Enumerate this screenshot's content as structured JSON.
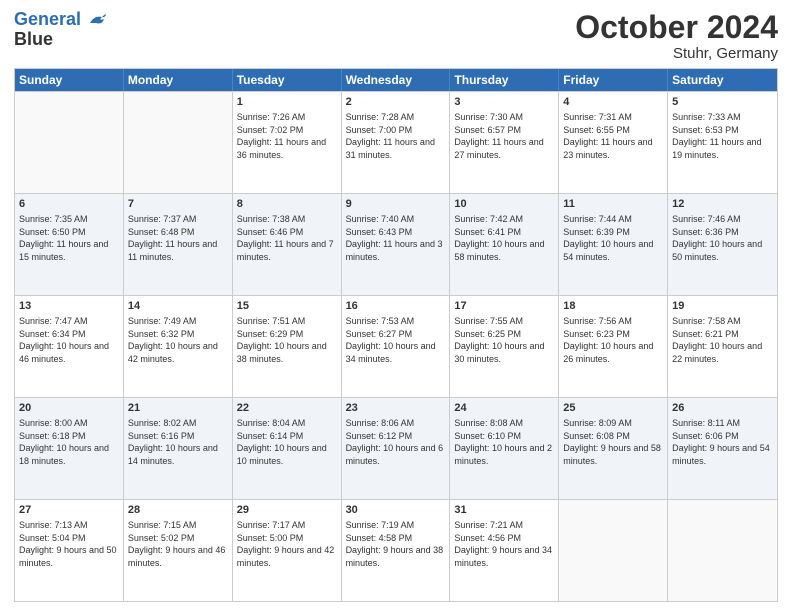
{
  "header": {
    "logo_line1": "General",
    "logo_line2": "Blue",
    "month": "October 2024",
    "location": "Stuhr, Germany"
  },
  "weekdays": [
    "Sunday",
    "Monday",
    "Tuesday",
    "Wednesday",
    "Thursday",
    "Friday",
    "Saturday"
  ],
  "rows": [
    [
      {
        "day": "",
        "sunrise": "",
        "sunset": "",
        "daylight": ""
      },
      {
        "day": "",
        "sunrise": "",
        "sunset": "",
        "daylight": ""
      },
      {
        "day": "1",
        "sunrise": "Sunrise: 7:26 AM",
        "sunset": "Sunset: 7:02 PM",
        "daylight": "Daylight: 11 hours and 36 minutes."
      },
      {
        "day": "2",
        "sunrise": "Sunrise: 7:28 AM",
        "sunset": "Sunset: 7:00 PM",
        "daylight": "Daylight: 11 hours and 31 minutes."
      },
      {
        "day": "3",
        "sunrise": "Sunrise: 7:30 AM",
        "sunset": "Sunset: 6:57 PM",
        "daylight": "Daylight: 11 hours and 27 minutes."
      },
      {
        "day": "4",
        "sunrise": "Sunrise: 7:31 AM",
        "sunset": "Sunset: 6:55 PM",
        "daylight": "Daylight: 11 hours and 23 minutes."
      },
      {
        "day": "5",
        "sunrise": "Sunrise: 7:33 AM",
        "sunset": "Sunset: 6:53 PM",
        "daylight": "Daylight: 11 hours and 19 minutes."
      }
    ],
    [
      {
        "day": "6",
        "sunrise": "Sunrise: 7:35 AM",
        "sunset": "Sunset: 6:50 PM",
        "daylight": "Daylight: 11 hours and 15 minutes."
      },
      {
        "day": "7",
        "sunrise": "Sunrise: 7:37 AM",
        "sunset": "Sunset: 6:48 PM",
        "daylight": "Daylight: 11 hours and 11 minutes."
      },
      {
        "day": "8",
        "sunrise": "Sunrise: 7:38 AM",
        "sunset": "Sunset: 6:46 PM",
        "daylight": "Daylight: 11 hours and 7 minutes."
      },
      {
        "day": "9",
        "sunrise": "Sunrise: 7:40 AM",
        "sunset": "Sunset: 6:43 PM",
        "daylight": "Daylight: 11 hours and 3 minutes."
      },
      {
        "day": "10",
        "sunrise": "Sunrise: 7:42 AM",
        "sunset": "Sunset: 6:41 PM",
        "daylight": "Daylight: 10 hours and 58 minutes."
      },
      {
        "day": "11",
        "sunrise": "Sunrise: 7:44 AM",
        "sunset": "Sunset: 6:39 PM",
        "daylight": "Daylight: 10 hours and 54 minutes."
      },
      {
        "day": "12",
        "sunrise": "Sunrise: 7:46 AM",
        "sunset": "Sunset: 6:36 PM",
        "daylight": "Daylight: 10 hours and 50 minutes."
      }
    ],
    [
      {
        "day": "13",
        "sunrise": "Sunrise: 7:47 AM",
        "sunset": "Sunset: 6:34 PM",
        "daylight": "Daylight: 10 hours and 46 minutes."
      },
      {
        "day": "14",
        "sunrise": "Sunrise: 7:49 AM",
        "sunset": "Sunset: 6:32 PM",
        "daylight": "Daylight: 10 hours and 42 minutes."
      },
      {
        "day": "15",
        "sunrise": "Sunrise: 7:51 AM",
        "sunset": "Sunset: 6:29 PM",
        "daylight": "Daylight: 10 hours and 38 minutes."
      },
      {
        "day": "16",
        "sunrise": "Sunrise: 7:53 AM",
        "sunset": "Sunset: 6:27 PM",
        "daylight": "Daylight: 10 hours and 34 minutes."
      },
      {
        "day": "17",
        "sunrise": "Sunrise: 7:55 AM",
        "sunset": "Sunset: 6:25 PM",
        "daylight": "Daylight: 10 hours and 30 minutes."
      },
      {
        "day": "18",
        "sunrise": "Sunrise: 7:56 AM",
        "sunset": "Sunset: 6:23 PM",
        "daylight": "Daylight: 10 hours and 26 minutes."
      },
      {
        "day": "19",
        "sunrise": "Sunrise: 7:58 AM",
        "sunset": "Sunset: 6:21 PM",
        "daylight": "Daylight: 10 hours and 22 minutes."
      }
    ],
    [
      {
        "day": "20",
        "sunrise": "Sunrise: 8:00 AM",
        "sunset": "Sunset: 6:18 PM",
        "daylight": "Daylight: 10 hours and 18 minutes."
      },
      {
        "day": "21",
        "sunrise": "Sunrise: 8:02 AM",
        "sunset": "Sunset: 6:16 PM",
        "daylight": "Daylight: 10 hours and 14 minutes."
      },
      {
        "day": "22",
        "sunrise": "Sunrise: 8:04 AM",
        "sunset": "Sunset: 6:14 PM",
        "daylight": "Daylight: 10 hours and 10 minutes."
      },
      {
        "day": "23",
        "sunrise": "Sunrise: 8:06 AM",
        "sunset": "Sunset: 6:12 PM",
        "daylight": "Daylight: 10 hours and 6 minutes."
      },
      {
        "day": "24",
        "sunrise": "Sunrise: 8:08 AM",
        "sunset": "Sunset: 6:10 PM",
        "daylight": "Daylight: 10 hours and 2 minutes."
      },
      {
        "day": "25",
        "sunrise": "Sunrise: 8:09 AM",
        "sunset": "Sunset: 6:08 PM",
        "daylight": "Daylight: 9 hours and 58 minutes."
      },
      {
        "day": "26",
        "sunrise": "Sunrise: 8:11 AM",
        "sunset": "Sunset: 6:06 PM",
        "daylight": "Daylight: 9 hours and 54 minutes."
      }
    ],
    [
      {
        "day": "27",
        "sunrise": "Sunrise: 7:13 AM",
        "sunset": "Sunset: 5:04 PM",
        "daylight": "Daylight: 9 hours and 50 minutes."
      },
      {
        "day": "28",
        "sunrise": "Sunrise: 7:15 AM",
        "sunset": "Sunset: 5:02 PM",
        "daylight": "Daylight: 9 hours and 46 minutes."
      },
      {
        "day": "29",
        "sunrise": "Sunrise: 7:17 AM",
        "sunset": "Sunset: 5:00 PM",
        "daylight": "Daylight: 9 hours and 42 minutes."
      },
      {
        "day": "30",
        "sunrise": "Sunrise: 7:19 AM",
        "sunset": "Sunset: 4:58 PM",
        "daylight": "Daylight: 9 hours and 38 minutes."
      },
      {
        "day": "31",
        "sunrise": "Sunrise: 7:21 AM",
        "sunset": "Sunset: 4:56 PM",
        "daylight": "Daylight: 9 hours and 34 minutes."
      },
      {
        "day": "",
        "sunrise": "",
        "sunset": "",
        "daylight": ""
      },
      {
        "day": "",
        "sunrise": "",
        "sunset": "",
        "daylight": ""
      }
    ]
  ]
}
